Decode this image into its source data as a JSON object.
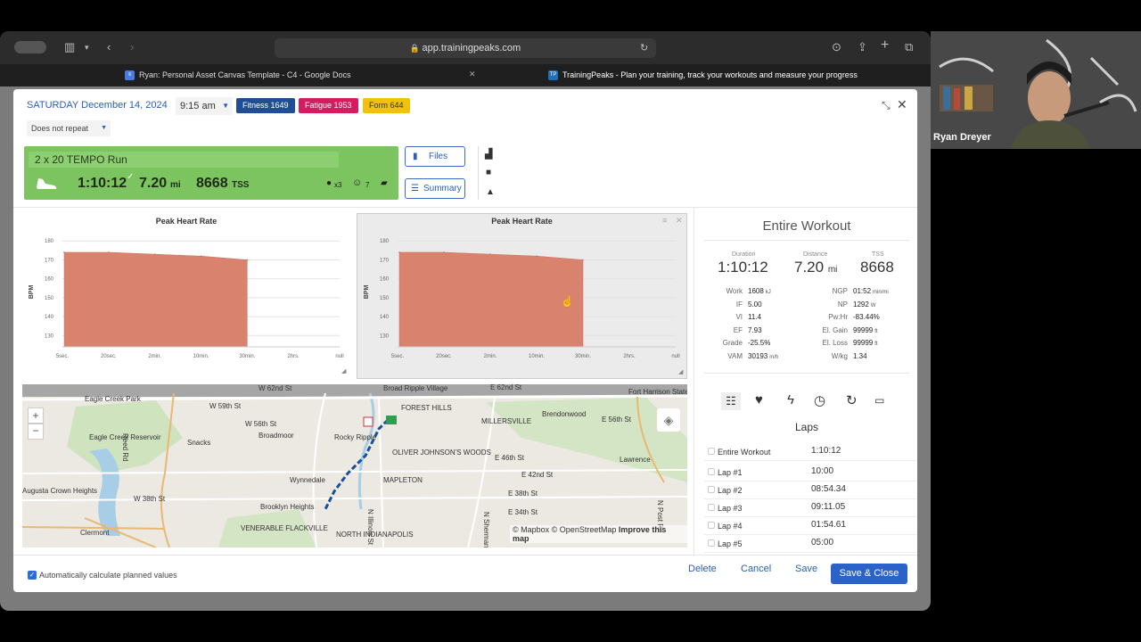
{
  "browser": {
    "url": "app.trainingpeaks.com",
    "tabs": [
      {
        "label": "Ryan: Personal Asset Canvas Template - C4 - Google Docs"
      },
      {
        "label": "TrainingPeaks - Plan your training, track your workouts and measure your progress"
      }
    ]
  },
  "header": {
    "date": "SATURDAY December 14, 2024",
    "time": "9:15 am",
    "fitness": "Fitness 1649",
    "fatigue": "Fatigue 1953",
    "form": "Form 644",
    "repeat": "Does not repeat"
  },
  "workout": {
    "title": "2 x 20 TEMPO Run",
    "duration": "1:10:12",
    "distance": "7.20",
    "distance_unit": "mi",
    "tss": "8668",
    "tss_unit": "TSS",
    "shoe_count": "x3",
    "feel": "7"
  },
  "buttons": {
    "files": "Files",
    "summary": "Summary",
    "delete": "Delete",
    "cancel": "Cancel",
    "save": "Save",
    "save_close": "Save & Close"
  },
  "charts": [
    {
      "title": "Peak Heart Rate",
      "ylabel": "BPM",
      "yticks": [
        "180",
        "170",
        "160",
        "150",
        "140",
        "130"
      ],
      "xticks": [
        "5sec.",
        "20sec.",
        "2min.",
        "10min.",
        "30min.",
        "2hrs.",
        "null"
      ]
    },
    {
      "title": "Peak Heart Rate",
      "ylabel": "BPM",
      "yticks": [
        "180",
        "170",
        "160",
        "150",
        "140",
        "130"
      ],
      "xticks": [
        "5sec.",
        "20sec.",
        "2min.",
        "10min.",
        "30min.",
        "2hrs.",
        "null"
      ]
    }
  ],
  "chart_data": [
    {
      "type": "area",
      "title": "Peak Heart Rate",
      "ylabel": "BPM",
      "x": [
        "5sec.",
        "20sec.",
        "2min.",
        "10min.",
        "30min.",
        "2hrs.",
        "null"
      ],
      "y": [
        174,
        174,
        173,
        172,
        170,
        null,
        null
      ],
      "ylim": [
        124,
        182
      ]
    },
    {
      "type": "area",
      "title": "Peak Heart Rate",
      "ylabel": "BPM",
      "x": [
        "5sec.",
        "20sec.",
        "2min.",
        "10min.",
        "30min.",
        "2hrs.",
        "null"
      ],
      "y": [
        174,
        174,
        173,
        172,
        170,
        null,
        null
      ],
      "ylim": [
        124,
        182
      ]
    }
  ],
  "summary": {
    "heading": "Entire Workout",
    "duration_label": "Duration",
    "duration": "1:10:12",
    "distance_label": "Distance",
    "distance": "7.20",
    "distance_unit": "mi",
    "tss_label": "TSS",
    "tss": "8668",
    "left": [
      {
        "k": "Work",
        "v": "1608",
        "u": "kJ"
      },
      {
        "k": "IF",
        "v": "5.00",
        "u": ""
      },
      {
        "k": "VI",
        "v": "11.4",
        "u": ""
      },
      {
        "k": "EF",
        "v": "7.93",
        "u": ""
      },
      {
        "k": "Grade",
        "v": "-25.5%",
        "u": ""
      },
      {
        "k": "VAM",
        "v": "30193",
        "u": "m/h"
      }
    ],
    "right": [
      {
        "k": "NGP",
        "v": "01:52",
        "u": "min/mi"
      },
      {
        "k": "NP",
        "v": "1292",
        "u": "W"
      },
      {
        "k": "Pw:Hr",
        "v": "-83.44%",
        "u": ""
      },
      {
        "k": "El. Gain",
        "v": "99999",
        "u": "ft"
      },
      {
        "k": "El. Loss",
        "v": "99999",
        "u": "ft"
      },
      {
        "k": "W/kg",
        "v": "1.34",
        "u": ""
      }
    ]
  },
  "laps": {
    "heading": "Laps",
    "items": [
      {
        "name": "Entire Workout",
        "time": "1:10:12"
      },
      {
        "name": "Lap #1",
        "time": "10:00"
      },
      {
        "name": "Lap #2",
        "time": "08:54.34"
      },
      {
        "name": "Lap #3",
        "time": "09:11.05"
      },
      {
        "name": "Lap #4",
        "time": "01:54.61"
      },
      {
        "name": "Lap #5",
        "time": "05:00"
      }
    ]
  },
  "map": {
    "attribution_mapbox": "© Mapbox",
    "attribution_osm": "© OpenStreetMap",
    "improve": "Improve this map",
    "labels": [
      "W 62nd St",
      "Broad Ripple Village",
      "E 62nd St",
      "Fort Harrison State Park",
      "Eagle Creek Park",
      "W 59th St",
      "W 56th St",
      "Broadmoor",
      "FOREST HILLS",
      "Brendonwood",
      "E 56th St",
      "MILLERSVILLE",
      "Eagle Creek Reservoir",
      "Snacks",
      "Rocky Ripple",
      "OLIVER JOHNSON'S WOODS",
      "E 46th St",
      "Lawrence",
      "Wynnedale",
      "MAPLETON",
      "E 42nd St",
      "E 38th St",
      "Brooklyn Heights",
      "W 38th St",
      "E 34th St",
      "Clermont",
      "VENERABLE FLACKVILLE",
      "NORTH INDIANAPOLIS",
      "Reed Rd",
      "N Illinois St",
      "N Sherman",
      "N Post Rd",
      "Augusta Crown Heights"
    ]
  },
  "footer": {
    "auto_calc": "Automatically calculate planned values"
  },
  "video": {
    "name": "Ryan Dreyer"
  }
}
